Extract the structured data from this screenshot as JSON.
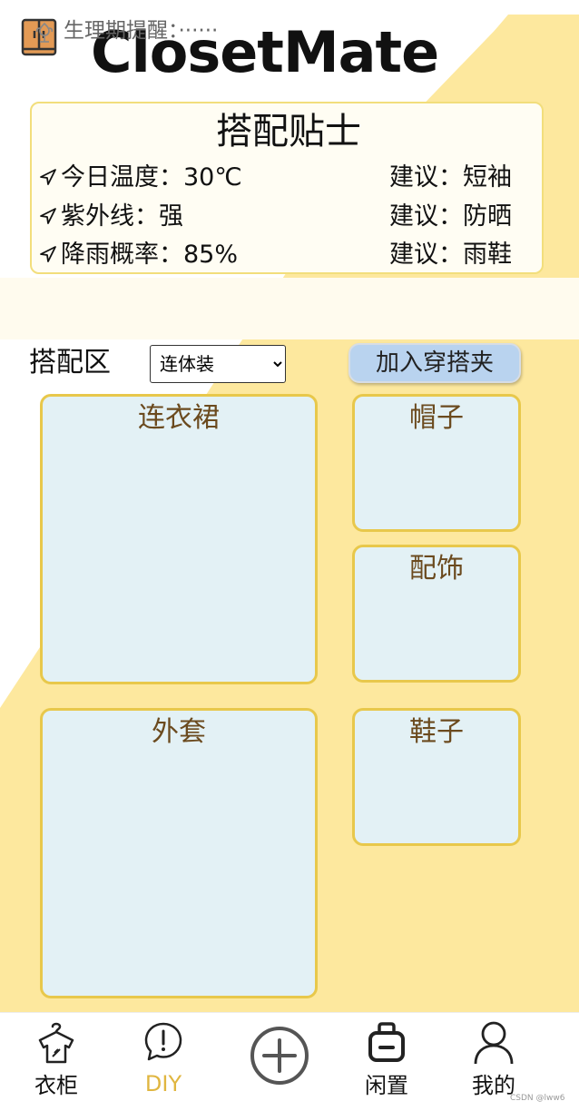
{
  "app": {
    "title": "ClosetMate",
    "logo_icon": "wardrobe-icon",
    "accent_color": "#fde89e"
  },
  "tips": {
    "title": "搭配贴士",
    "rows": [
      {
        "text": "今日温度：30℃",
        "advice": "建议：短袖"
      },
      {
        "text": "紫外线：强",
        "advice": "建议：防晒"
      },
      {
        "text": "降雨概率：85%",
        "advice": "建议：雨鞋"
      }
    ]
  },
  "reminder": {
    "icon": "flower-icon",
    "text": "生理期提醒：······"
  },
  "match": {
    "label": "搭配区",
    "select_value": "连体装",
    "add_button": "加入穿搭夹"
  },
  "slots": {
    "dress": "连衣裙",
    "hat": "帽子",
    "accessory": "配饰",
    "coat": "外套",
    "shoes": "鞋子"
  },
  "nav": {
    "wardrobe": "衣柜",
    "diy": "DIY",
    "idle": "闲置",
    "mine": "我的",
    "active_color": "#e0b640"
  },
  "watermark": "CSDN @lww6"
}
